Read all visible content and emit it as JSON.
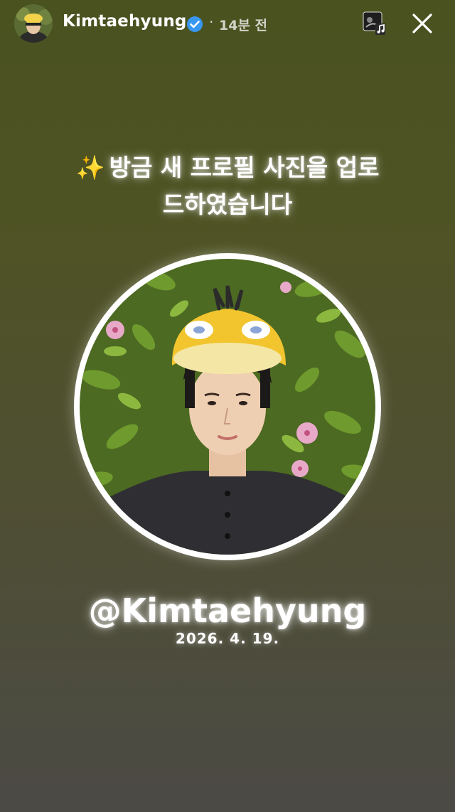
{
  "header": {
    "username": "Kimtaehyung",
    "separator": "·",
    "time_ago": "14분 전"
  },
  "caption": {
    "emoji": "✨",
    "text_line1": "방금 새 프로필 사진을 업로",
    "text_line2": "드하였습니다"
  },
  "profile": {
    "handle": "@Kimtaehyung",
    "date": "2026. 4. 19."
  },
  "icons": {
    "verified": "verified-badge-icon",
    "music": "music-note-icon",
    "close": "close-icon"
  },
  "colors": {
    "verified_blue": "#3897f0",
    "background_top": "#4a5220",
    "background_bottom": "#4b4a45"
  }
}
